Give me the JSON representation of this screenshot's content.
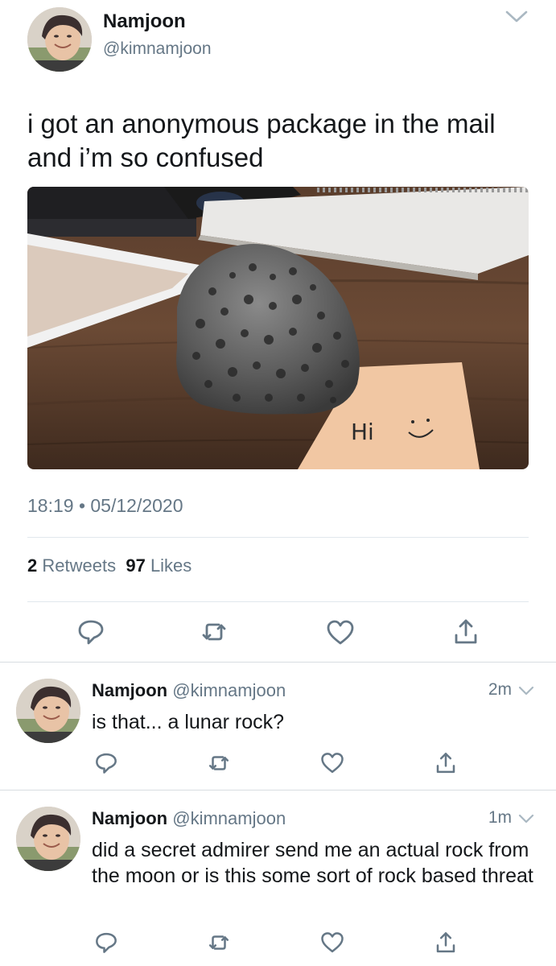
{
  "main_tweet": {
    "author_name": "Namjoon",
    "author_handle": "@kimnamjoon",
    "text": "i got an anonymous package in the mail and i’m so confused",
    "photo_note_text": "Hi",
    "timestamp": "18:19 • 05/12/2020",
    "retweets_count": "2",
    "retweets_label": "Retweets",
    "likes_count": "97",
    "likes_label": "Likes"
  },
  "replies": [
    {
      "author_name": "Namjoon",
      "author_handle": "@kimnamjoon",
      "time": "2m",
      "text": "is that... a lunar rock?"
    },
    {
      "author_name": "Namjoon",
      "author_handle": "@kimnamjoon",
      "time": "1m",
      "text": "did a secret admirer send me an actual rock from the moon or is this some sort of rock based threat"
    }
  ],
  "icons": {
    "reply": "speech-bubble-icon",
    "retweet": "retweet-arrows-icon",
    "like": "heart-icon",
    "share": "share-arrow-icon",
    "more": "chevron-down-icon"
  },
  "colors": {
    "text": "#14171a",
    "secondary": "#657786",
    "divider": "#e1e8ed",
    "icon": "#657786"
  }
}
